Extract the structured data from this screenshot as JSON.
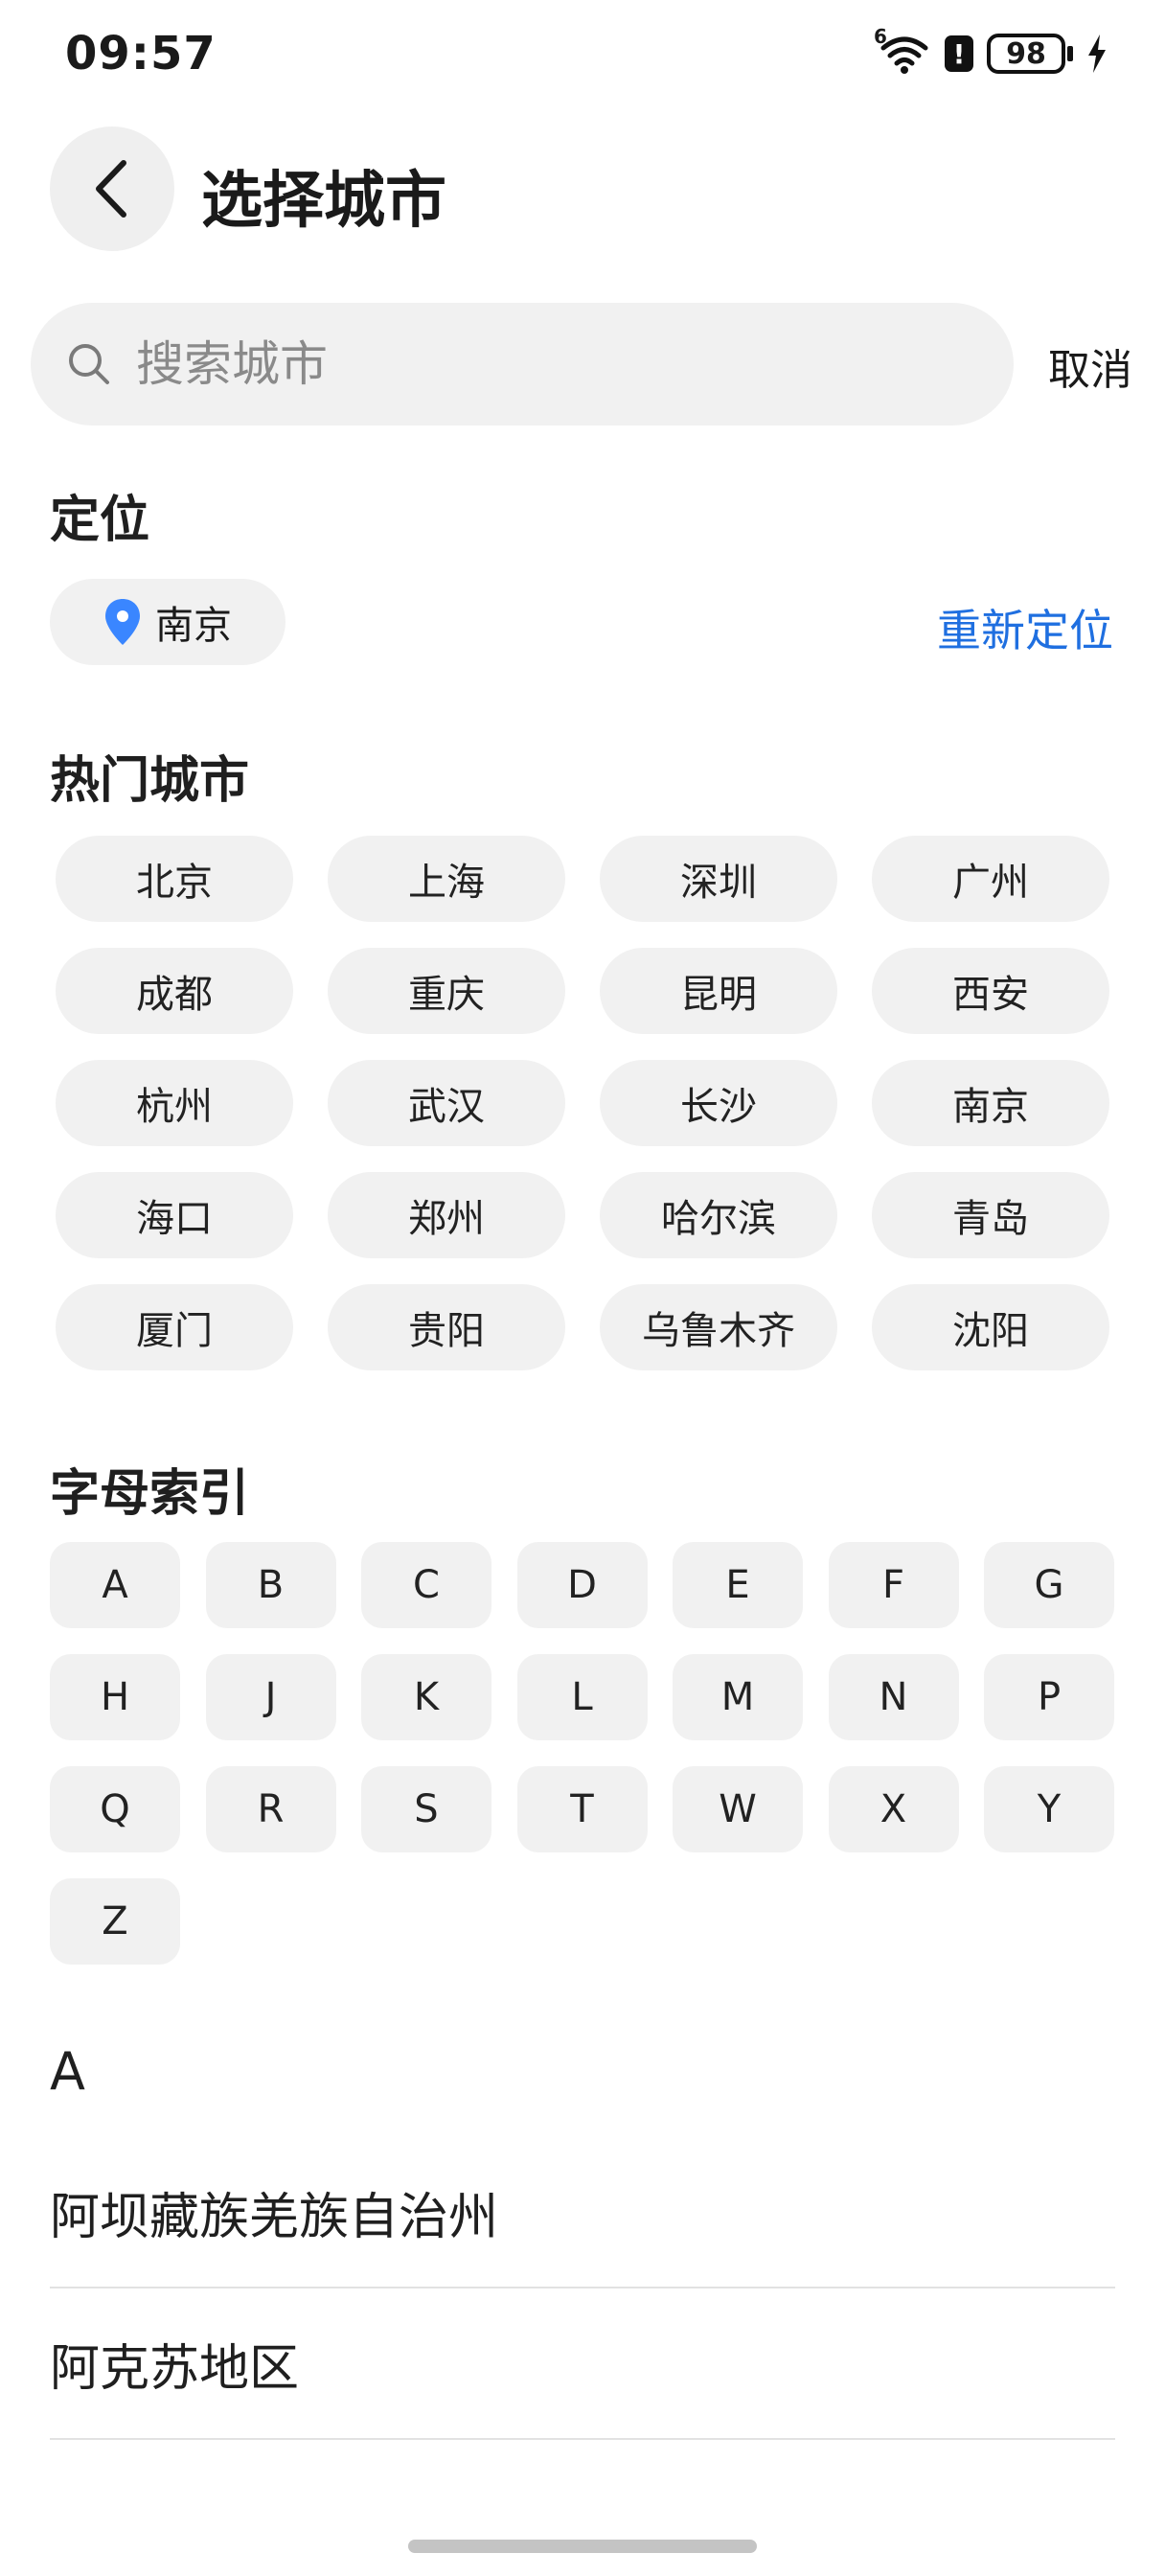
{
  "status_bar": {
    "time": "09:57",
    "network": "6",
    "battery": "98"
  },
  "header": {
    "title": "选择城市"
  },
  "search": {
    "placeholder": "搜索城市",
    "value": "",
    "cancel_label": "取消"
  },
  "location": {
    "section_title": "定位",
    "current_city": "南京",
    "relocate_label": "重新定位",
    "pin_color": "#3a86ff"
  },
  "hot_cities": {
    "section_title": "热门城市",
    "items": [
      "北京",
      "上海",
      "深圳",
      "广州",
      "成都",
      "重庆",
      "昆明",
      "西安",
      "杭州",
      "武汉",
      "长沙",
      "南京",
      "海口",
      "郑州",
      "哈尔滨",
      "青岛",
      "厦门",
      "贵阳",
      "乌鲁木齐",
      "沈阳"
    ]
  },
  "alphabet_index": {
    "section_title": "字母索引",
    "letters": [
      "A",
      "B",
      "C",
      "D",
      "E",
      "F",
      "G",
      "H",
      "J",
      "K",
      "L",
      "M",
      "N",
      "P",
      "Q",
      "R",
      "S",
      "T",
      "W",
      "X",
      "Y",
      "Z"
    ]
  },
  "city_list": {
    "group_header": "A",
    "items": [
      "阿坝藏族羌族自治州",
      "阿克苏地区"
    ]
  },
  "colors": {
    "accent": "#1f6fe0",
    "chip_bg": "#f1f1f1"
  }
}
